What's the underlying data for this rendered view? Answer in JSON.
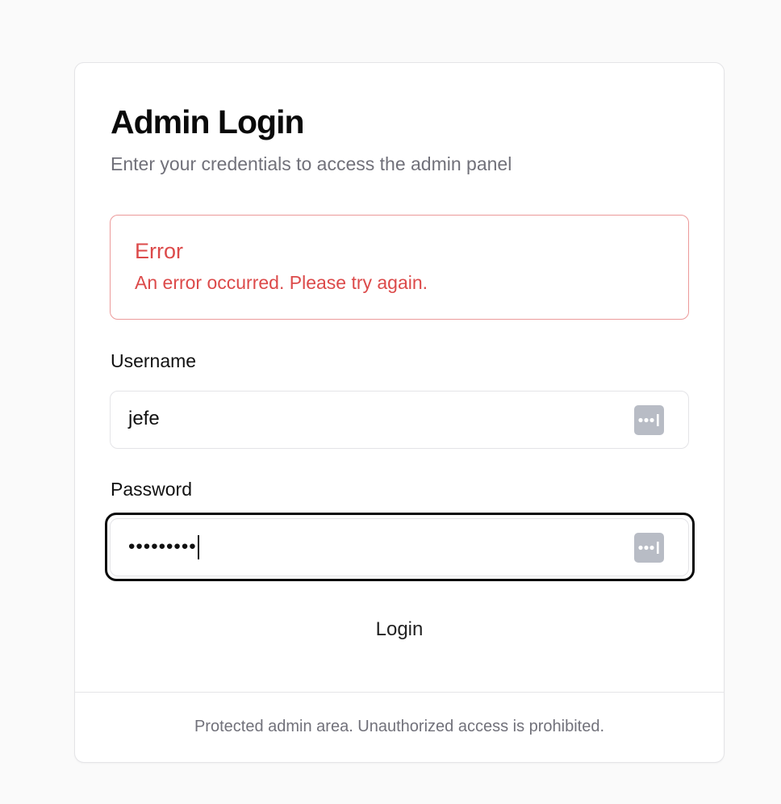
{
  "login": {
    "title": "Admin Login",
    "subtitle": "Enter your credentials to access the admin panel",
    "error": {
      "title": "Error",
      "message": "An error occurred. Please try again.",
      "color": "#dc4a4a"
    },
    "username": {
      "label": "Username",
      "value": "jefe",
      "icon": "password-manager-icon"
    },
    "password": {
      "label": "Password",
      "masked_value": "•••••••••",
      "focused": true,
      "icon": "password-manager-icon"
    },
    "submit_label": "Login",
    "footer": "Protected admin area. Unauthorized access is prohibited."
  }
}
